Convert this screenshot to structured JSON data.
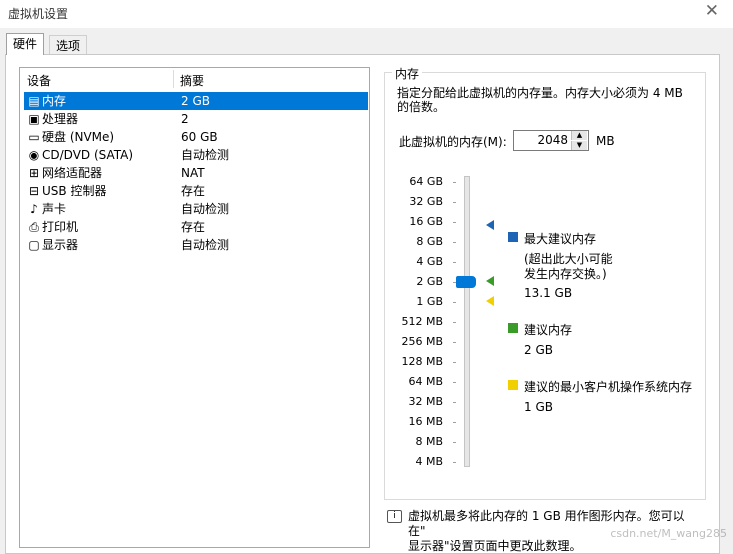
{
  "window": {
    "title": "虚拟机设置",
    "close_glyph": "✕"
  },
  "tabs": [
    {
      "label": "硬件",
      "active": true
    },
    {
      "label": "选项",
      "active": false
    }
  ],
  "device_list": {
    "col_device": "设备",
    "col_summary": "摘要",
    "items": [
      {
        "icon": "memory-icon",
        "glyph": "▤",
        "name": "内存",
        "summary": "2 GB",
        "selected": true
      },
      {
        "icon": "processor-icon",
        "glyph": "▣",
        "name": "处理器",
        "summary": "2",
        "selected": false
      },
      {
        "icon": "disk-icon",
        "glyph": "▭",
        "name": "硬盘 (NVMe)",
        "summary": "60 GB",
        "selected": false
      },
      {
        "icon": "cd-icon",
        "glyph": "◉",
        "name": "CD/DVD (SATA)",
        "summary": "自动检测",
        "selected": false
      },
      {
        "icon": "network-icon",
        "glyph": "⊞",
        "name": "网络适配器",
        "summary": "NAT",
        "selected": false
      },
      {
        "icon": "usb-icon",
        "glyph": "⊟",
        "name": "USB 控制器",
        "summary": "存在",
        "selected": false
      },
      {
        "icon": "sound-icon",
        "glyph": "♪",
        "name": "声卡",
        "summary": "自动检测",
        "selected": false
      },
      {
        "icon": "printer-icon",
        "glyph": "⎙",
        "name": "打印机",
        "summary": "存在",
        "selected": false
      },
      {
        "icon": "display-icon",
        "glyph": "▢",
        "name": "显示器",
        "summary": "自动检测",
        "selected": false
      }
    ]
  },
  "memory": {
    "group_title": "内存",
    "description": "指定分配给此虚拟机的内存量。内存大小必须为 4 MB 的倍数。",
    "field_label": "此虚拟机的内存(M):",
    "value": "2048",
    "unit": "MB",
    "scale_labels": [
      "64 GB",
      "32 GB",
      "16 GB",
      "8 GB",
      "4 GB",
      "2 GB",
      "1 GB",
      "512 MB",
      "256 MB",
      "128 MB",
      "64 MB",
      "32 MB",
      "16 MB",
      "8 MB",
      "4 MB"
    ],
    "slider_value": "2 GB",
    "markers": {
      "max_recommended": {
        "level": "16 GB",
        "color": "#1e64b4"
      },
      "recommended": {
        "level": "2 GB",
        "color": "#3a9a2a"
      },
      "min_guest": {
        "level": "1 GB",
        "color": "#f0d000"
      }
    },
    "legend": {
      "max_title": "最大建议内存",
      "max_note_line1": "(超出此大小可能",
      "max_note_line2": "发生内存交换。)",
      "max_value": "13.1 GB",
      "rec_title": "建议内存",
      "rec_value": "2 GB",
      "min_title": "建议的最小客户机操作系统内存",
      "min_value": "1 GB"
    }
  },
  "info": {
    "line1": "虚拟机最多将此内存的 1 GB 用作图形内存。您可以在\"",
    "line2": "显示器\"设置页面中更改此数理。"
  },
  "watermark": "csdn.net/M_wang285"
}
